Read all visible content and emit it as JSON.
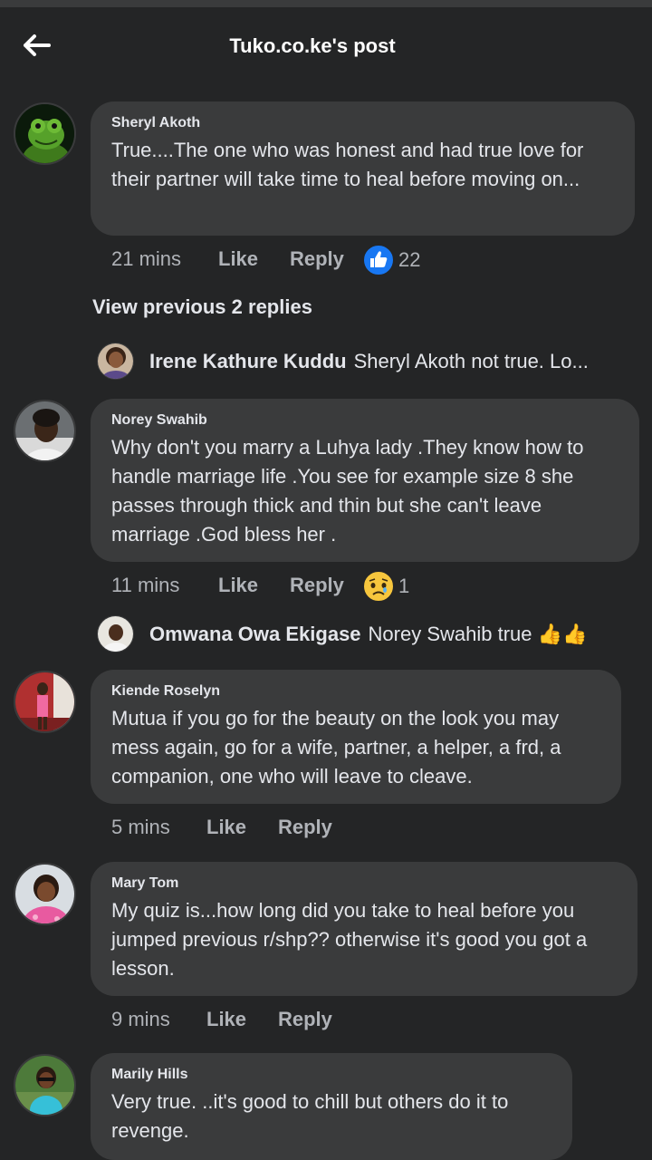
{
  "header": {
    "title": "Tuko.co.ke's post"
  },
  "comments": [
    {
      "author": "Sheryl Akoth",
      "text": "True....The one who was honest and had true love for their partner will take time to heal before moving on...",
      "time": "21 mins",
      "like_label": "Like",
      "reply_label": "Reply",
      "reaction_icon": "like-reaction-icon",
      "reaction_count": "22"
    },
    {
      "author": "Norey Swahib",
      "text": "Why don't you marry a Luhya lady .They know how to handle marriage life .You see for example size 8 she passes through thick and thin but she can't leave marriage .God bless her .",
      "time": "11 mins",
      "like_label": "Like",
      "reply_label": "Reply",
      "reaction_icon": "sad-reaction-icon",
      "reaction_count": "1"
    },
    {
      "author": "Kiende Roselyn",
      "text": "Mutua if you go for the beauty on the look you may mess again, go for a wife, partner, a helper, a frd, a companion, one who will leave to cleave.",
      "time": "5 mins",
      "like_label": "Like",
      "reply_label": "Reply"
    },
    {
      "author": "Mary Tom",
      "text": "My quiz is...how long did you take to heal before you jumped previous r/shp?? otherwise it's good you got a lesson.",
      "time": "9 mins",
      "like_label": "Like",
      "reply_label": "Reply"
    },
    {
      "author": "Marily Hills",
      "text": "Very true. ..it's good to chill but others do it to revenge."
    }
  ],
  "view_previous": "View previous 2 replies",
  "replies": [
    {
      "author": "Irene Kathure Kuddu",
      "text": "Sheryl Akoth not true. Lo..."
    },
    {
      "author": "Omwana Owa Ekigase",
      "text": "Norey Swahib true 👍👍"
    }
  ],
  "colors": {
    "background": "#242526",
    "bubble": "#3a3b3c",
    "primary_text": "#e4e6eb",
    "secondary_text": "#b0b3b8",
    "like_blue": "#1877f2"
  }
}
